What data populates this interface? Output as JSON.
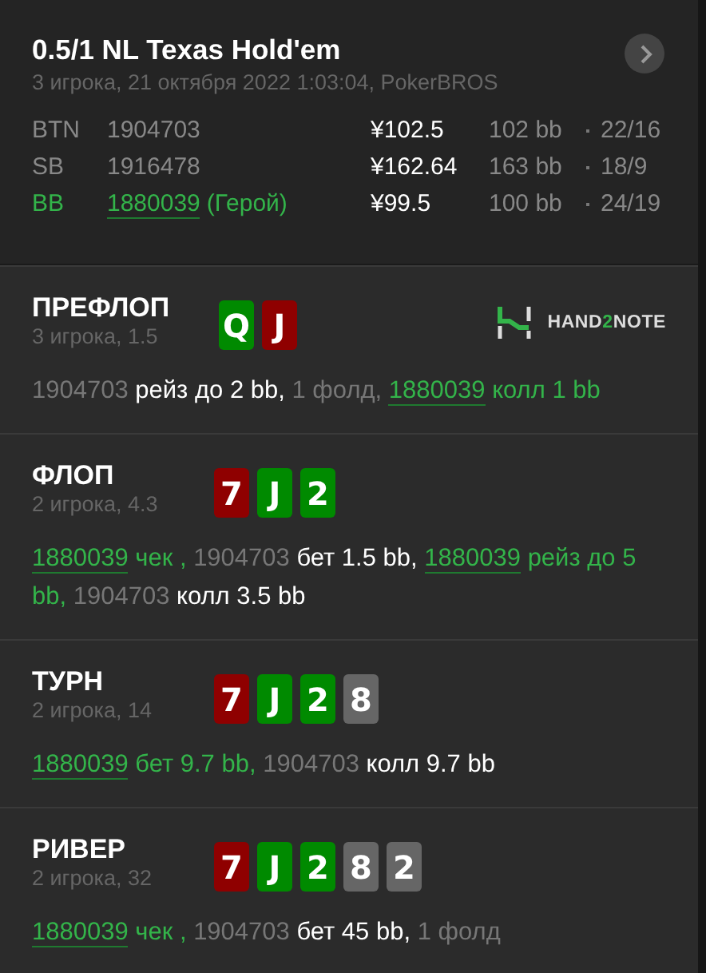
{
  "header": {
    "title": "0.5/1 NL Texas Hold'em",
    "subtitle": "3 игрока, 21 октября 2022 1:03:04, PokerBROS",
    "players": [
      {
        "position": "BTN",
        "id": "1904703",
        "stack": "¥102.5",
        "bb": "102 bb",
        "stats": "22/16",
        "hero": false
      },
      {
        "position": "SB",
        "id": "1916478",
        "stack": "¥162.64",
        "bb": "163 bb",
        "stats": "18/9",
        "hero": false
      },
      {
        "position": "BB",
        "id": "1880039",
        "hero_label": "(Герой)",
        "stack": "¥99.5",
        "bb": "100 bb",
        "stats": "24/19",
        "hero": true
      }
    ]
  },
  "logo": {
    "parts": [
      {
        "text": "HAND",
        "accent": false
      },
      {
        "text": "2",
        "accent": true
      },
      {
        "text": "NOTE",
        "accent": false
      }
    ]
  },
  "streets": [
    {
      "name": "ПРЕФЛОП",
      "info": "3 игрока, 1.5",
      "logo": true,
      "cards": [
        {
          "rank": "Q",
          "color": "#008a00"
        },
        {
          "rank": "J",
          "color": "#8f0000"
        }
      ],
      "actions": [
        {
          "kind": "player",
          "text": "1904703",
          "hero": false
        },
        {
          "kind": "action",
          "text": "рейз до 2 bb,",
          "hero": false
        },
        {
          "kind": "note",
          "text": "1 фолд,"
        },
        {
          "kind": "player",
          "text": "1880039",
          "hero": true
        },
        {
          "kind": "action",
          "text": "колл 1 bb",
          "hero": true
        }
      ]
    },
    {
      "name": "ФЛОП",
      "info": "2 игрока, 4.3",
      "logo": false,
      "cards": [
        {
          "rank": "7",
          "color": "#8f0000"
        },
        {
          "rank": "J",
          "color": "#008a00"
        },
        {
          "rank": "2",
          "color": "#008a00"
        }
      ],
      "actions": [
        {
          "kind": "player",
          "text": "1880039",
          "hero": true
        },
        {
          "kind": "action",
          "text": "чек ,",
          "hero": true
        },
        {
          "kind": "player",
          "text": "1904703",
          "hero": false
        },
        {
          "kind": "action",
          "text": "бет 1.5 bb,",
          "hero": false
        },
        {
          "kind": "player",
          "text": "1880039",
          "hero": true
        },
        {
          "kind": "action",
          "text": "рейз до 5 bb,",
          "hero": true
        },
        {
          "kind": "player",
          "text": "1904703",
          "hero": false
        },
        {
          "kind": "action",
          "text": "колл 3.5 bb",
          "hero": false
        }
      ]
    },
    {
      "name": "ТУРН",
      "info": "2 игрока, 14",
      "logo": false,
      "cards": [
        {
          "rank": "7",
          "color": "#8f0000"
        },
        {
          "rank": "J",
          "color": "#008a00"
        },
        {
          "rank": "2",
          "color": "#008a00"
        },
        {
          "rank": "8",
          "color": "#666666"
        }
      ],
      "actions": [
        {
          "kind": "player",
          "text": "1880039",
          "hero": true
        },
        {
          "kind": "action",
          "text": "бет 9.7 bb,",
          "hero": true
        },
        {
          "kind": "player",
          "text": "1904703",
          "hero": false
        },
        {
          "kind": "action",
          "text": "колл 9.7 bb",
          "hero": false
        }
      ]
    },
    {
      "name": "РИВЕР",
      "info": "2 игрока, 32",
      "logo": false,
      "cards": [
        {
          "rank": "7",
          "color": "#8f0000"
        },
        {
          "rank": "J",
          "color": "#008a00"
        },
        {
          "rank": "2",
          "color": "#008a00"
        },
        {
          "rank": "8",
          "color": "#666666"
        },
        {
          "rank": "2",
          "color": "#666666"
        }
      ],
      "actions": [
        {
          "kind": "player",
          "text": "1880039",
          "hero": true
        },
        {
          "kind": "action",
          "text": "чек ,",
          "hero": true
        },
        {
          "kind": "player",
          "text": "1904703",
          "hero": false
        },
        {
          "kind": "action",
          "text": "бет 45 bb,",
          "hero": false
        },
        {
          "kind": "note",
          "text": "1 фолд"
        }
      ]
    }
  ]
}
